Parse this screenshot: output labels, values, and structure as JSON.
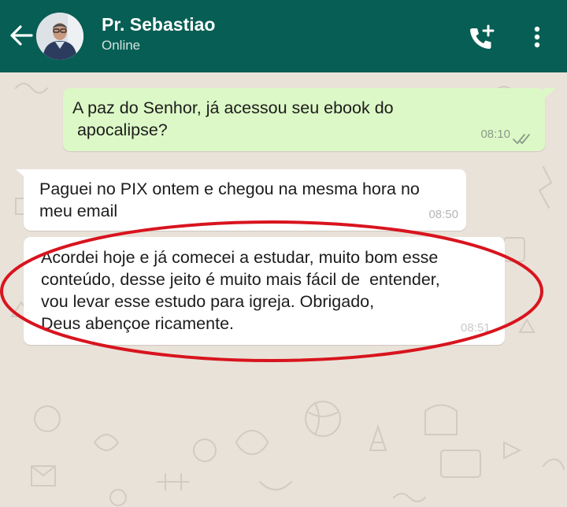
{
  "header": {
    "contact_name": "Pr. Sebastiao",
    "status": "Online",
    "back_icon": "arrow-left-icon",
    "call_icon": "add-call-icon",
    "menu_icon": "more-vertical-icon",
    "colors": {
      "bar": "#075e54",
      "status_text": "#cfe3df"
    }
  },
  "messages": [
    {
      "direction": "outgoing",
      "lines": [
        "A paz do Senhor, já acessou seu ebook do",
        " apocalipse?"
      ],
      "time": "08:10",
      "status_icon": "double-check-icon"
    },
    {
      "direction": "incoming",
      "lines": [
        "Paguei no PIX ontem e chegou na mesma hora no",
        "meu email"
      ],
      "time": "08:50"
    },
    {
      "direction": "incoming",
      "lines": [
        "Acordei hoje e já comecei a estudar, muito bom esse",
        "conteúdo, desse jeito é muito mais fácil de  entender,",
        "vou levar esse estudo para igreja. Obrigado,",
        "Deus abençoe ricamente."
      ],
      "time": "08:51",
      "highlighted": true
    }
  ],
  "colors": {
    "chat_background": "#e9e2d9",
    "outgoing_bubble": "#dcf8c6",
    "incoming_bubble": "#ffffff",
    "highlight_ellipse": "#d8141e"
  }
}
